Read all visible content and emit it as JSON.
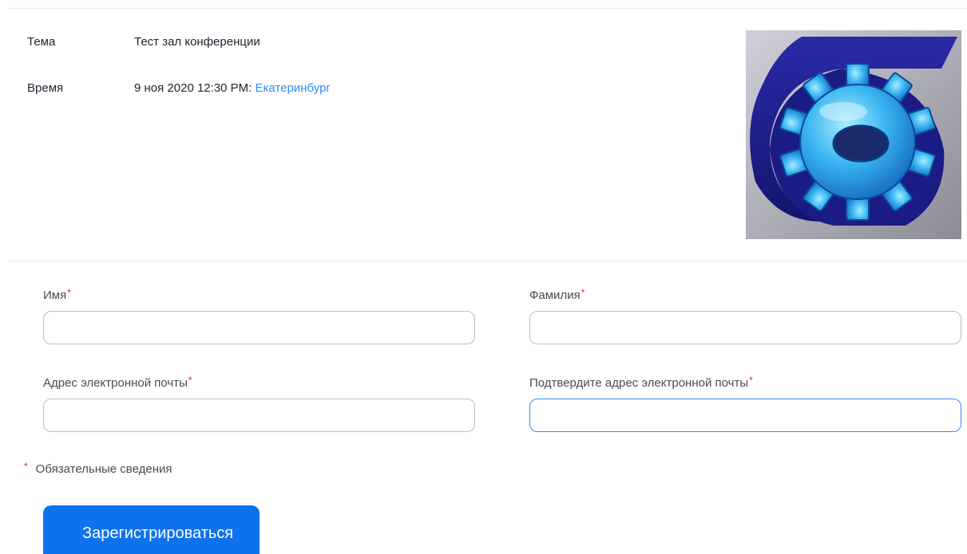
{
  "meeting": {
    "topic_label": "Тема",
    "topic_value": "Тест зал конференции",
    "time_label": "Время",
    "time_value": "9 ноя 2020 12:30 PM:",
    "timezone_link": "Екатеринбург"
  },
  "logo": {
    "icon": "gear-logo-icon",
    "colors": {
      "navy": "#1a1a8c",
      "gear_blue": "#2aa9f0",
      "gear_light": "#8fe0ff",
      "background": "#a8a8b0"
    }
  },
  "form": {
    "first_name_label": "Имя",
    "last_name_label": "Фамилия",
    "email_label": "Адрес электронной почты",
    "confirm_email_label": "Подтвердите адрес электронной почты",
    "required_marker": "*",
    "first_name_value": "",
    "last_name_value": "",
    "email_value": "",
    "confirm_email_value": "",
    "required_note": "Обязательные сведения",
    "register_button": "Зарегистрироваться"
  },
  "colors": {
    "accent": "#0e72ed",
    "link": "#2d8cff",
    "required": "#e02828",
    "focus_border": "#2d8cff"
  }
}
